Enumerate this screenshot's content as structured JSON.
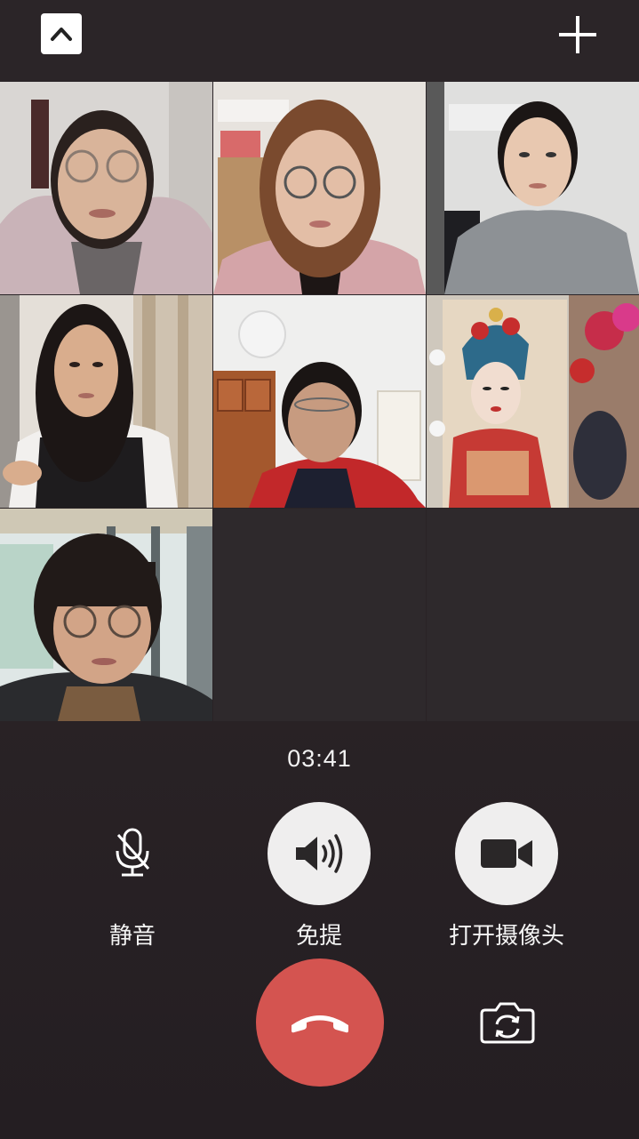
{
  "call": {
    "timer": "03:41"
  },
  "controls": {
    "mute_label": "静音",
    "speaker_label": "免提",
    "camera_label": "打开摄像头"
  },
  "icons": {
    "collapse": "chevron-up-icon",
    "add": "plus-icon",
    "mute": "microphone-off-icon",
    "speaker": "speaker-icon",
    "camera": "video-camera-icon",
    "hangup": "phone-hangup-icon",
    "flip": "camera-switch-icon"
  },
  "colors": {
    "background": "#2a2326",
    "hangup": "#d45450",
    "control_circle": "#efeeee"
  },
  "participants_count": 7
}
